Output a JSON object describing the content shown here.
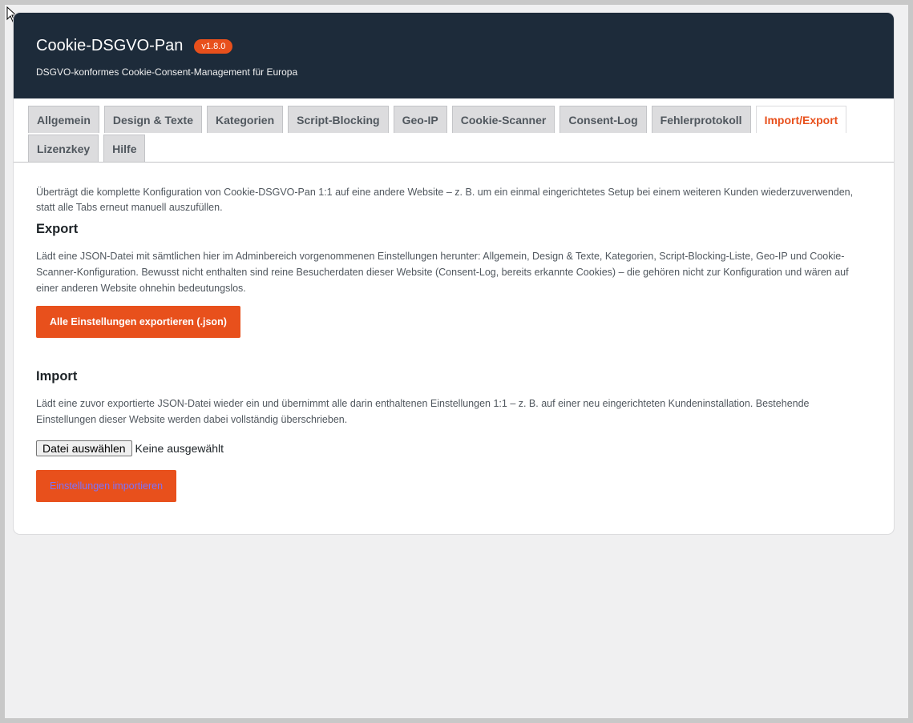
{
  "header": {
    "title": "Cookie-DSGVO-Pan",
    "version": "v1.8.0",
    "subtitle": "DSGVO-konformes Cookie-Consent-Management für Europa"
  },
  "tabs": [
    {
      "label": "Allgemein",
      "active": false
    },
    {
      "label": "Design & Texte",
      "active": false
    },
    {
      "label": "Kategorien",
      "active": false
    },
    {
      "label": "Script-Blocking",
      "active": false
    },
    {
      "label": "Geo-IP",
      "active": false
    },
    {
      "label": "Cookie-Scanner",
      "active": false
    },
    {
      "label": "Consent-Log",
      "active": false
    },
    {
      "label": "Fehlerprotokoll",
      "active": false
    },
    {
      "label": "Import/Export",
      "active": true
    },
    {
      "label": "Lizenzkey",
      "active": false
    },
    {
      "label": "Hilfe",
      "active": false
    }
  ],
  "content": {
    "intro": "Überträgt die komplette Konfiguration von Cookie-DSGVO-Pan 1:1 auf eine andere Website – z. B. um ein einmal eingerichtetes Setup bei einem weiteren Kunden wiederzuverwenden, statt alle Tabs erneut manuell auszufüllen.",
    "export": {
      "heading": "Export",
      "description": "Lädt eine JSON-Datei mit sämtlichen hier im Adminbereich vorgenommenen Einstellungen herunter: Allgemein, Design & Texte, Kategorien, Script-Blocking-Liste, Geo-IP und Cookie-Scanner-Konfiguration. Bewusst nicht enthalten sind reine Besucherdaten dieser Website (Consent-Log, bereits erkannte Cookies) – die gehören nicht zur Konfiguration und wären auf einer anderen Website ohnehin bedeutungslos.",
      "button_label": "Alle Einstellungen exportieren (.json)"
    },
    "import": {
      "heading": "Import",
      "description": "Lädt eine zuvor exportierte JSON-Datei wieder ein und übernimmt alle darin enthaltenen Einstellungen 1:1 – z. B. auf einer neu eingerichteten Kundeninstallation. Bestehende Einstellungen dieser Website werden dabei vollständig überschrieben.",
      "file_button_label": "Datei auswählen",
      "file_status": "Keine ausgewählt",
      "button_label": "Einstellungen importieren"
    }
  },
  "colors": {
    "header_bg": "#1d2b3a",
    "accent": "#e8501c",
    "page_bg": "#f0f0f1"
  }
}
